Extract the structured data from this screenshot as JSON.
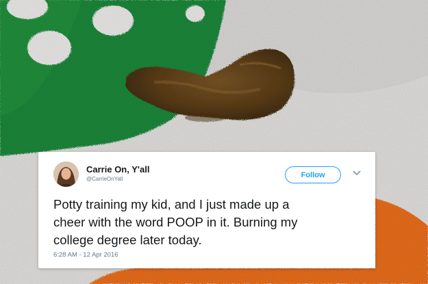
{
  "photo": {
    "subject": "dog-poop-on-rug-photo",
    "colors": {
      "rug_green": "#1f8a3c",
      "rug_white": "#eceae8",
      "rug_orange": "#f0701e",
      "poop_brown": "#6b4a1f"
    }
  },
  "tweet": {
    "author_name": "Carrie On, Y'all",
    "author_handle": "@CarrieOnYall",
    "follow_label": "Follow",
    "text_lines": [
      "Potty training my kid, and I just made up a",
      "cheer with the word POOP in it. Burning my",
      "college degree later today."
    ],
    "timestamp": "6:28 AM - 12 Apr 2016",
    "colors": {
      "accent": "#1da1f2",
      "text": "#14171a",
      "muted": "#657786"
    }
  }
}
